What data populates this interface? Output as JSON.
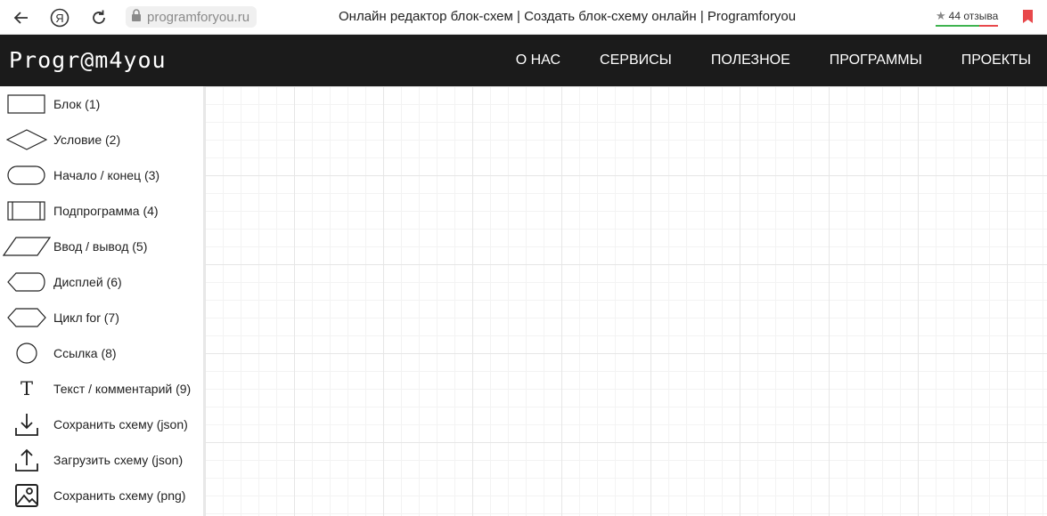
{
  "browser": {
    "url": "programforyou.ru",
    "tab_title": "Онлайн редактор блок-схем | Создать блок-схему онлайн | Programforyou",
    "reviews": "44 отзыва",
    "icons": [
      "back-icon",
      "yandex-icon",
      "reload-icon",
      "lock-icon",
      "star-icon",
      "bookmark-icon"
    ]
  },
  "header": {
    "logo": "Progr@m4you",
    "nav": [
      "О НАС",
      "СЕРВИСЫ",
      "ПОЛЕЗНОЕ",
      "ПРОГРАММЫ",
      "ПРОЕКТЫ"
    ]
  },
  "sidebar": {
    "tools": [
      {
        "label": "Блок (1)",
        "icon": "block-shape-icon"
      },
      {
        "label": "Условие (2)",
        "icon": "condition-diamond-icon"
      },
      {
        "label": "Начало / конец (3)",
        "icon": "terminator-shape-icon"
      },
      {
        "label": "Подпрограмма (4)",
        "icon": "subroutine-shape-icon"
      },
      {
        "label": "Ввод / вывод (5)",
        "icon": "io-parallelogram-icon"
      },
      {
        "label": "Дисплей (6)",
        "icon": "display-shape-icon"
      },
      {
        "label": "Цикл for (7)",
        "icon": "loop-hexagon-icon"
      },
      {
        "label": "Ссылка (8)",
        "icon": "connector-circle-icon"
      },
      {
        "label": "Текст / комментарий (9)",
        "icon": "text-icon"
      },
      {
        "label": "Сохранить схему (json)",
        "icon": "download-icon"
      },
      {
        "label": "Загрузить схему (json)",
        "icon": "upload-icon"
      },
      {
        "label": "Сохранить схему (png)",
        "icon": "image-icon"
      }
    ]
  },
  "colors": {
    "header_bg": "#1b1b1b",
    "grid_major": "#e6e6e6",
    "grid_minor": "#f3f3f3",
    "reviews_good": "#3fb34f",
    "reviews_bad": "#e8484b",
    "bookmark": "#e8484b"
  }
}
